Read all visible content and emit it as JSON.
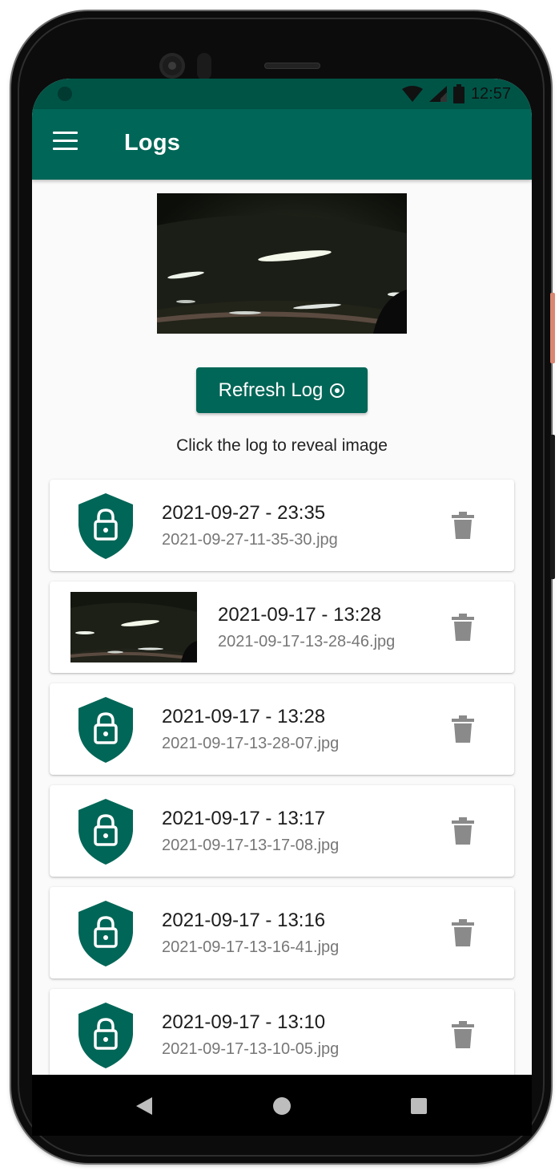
{
  "status_bar": {
    "time": "12:57",
    "icons": [
      "wifi-icon",
      "cell-signal-icon",
      "battery-icon"
    ]
  },
  "app_bar": {
    "title": "Logs",
    "menu_icon": "hamburger-menu-icon"
  },
  "main": {
    "refresh_button_label": "Refresh Log",
    "refresh_icon": "refresh-circle-icon",
    "hint": "Click the log to reveal image"
  },
  "logs": [
    {
      "timestamp": "2021-09-27 - 23:35",
      "filename": "2021-09-27-11-35-30.jpg",
      "revealed": false
    },
    {
      "timestamp": "2021-09-17 - 13:28",
      "filename": "2021-09-17-13-28-46.jpg",
      "revealed": true
    },
    {
      "timestamp": "2021-09-17 - 13:28",
      "filename": "2021-09-17-13-28-07.jpg",
      "revealed": false
    },
    {
      "timestamp": "2021-09-17 - 13:17",
      "filename": "2021-09-17-13-17-08.jpg",
      "revealed": false
    },
    {
      "timestamp": "2021-09-17 - 13:16",
      "filename": "2021-09-17-13-16-41.jpg",
      "revealed": false
    },
    {
      "timestamp": "2021-09-17 - 13:10",
      "filename": "2021-09-17-13-10-05.jpg",
      "revealed": false
    }
  ],
  "colors": {
    "primary": "#006657",
    "status_bar": "#005446",
    "background": "#fafafa",
    "trash_icon": "#8a8a8a"
  },
  "navigation": {
    "icons": [
      "back-icon",
      "home-icon",
      "recents-icon"
    ]
  }
}
